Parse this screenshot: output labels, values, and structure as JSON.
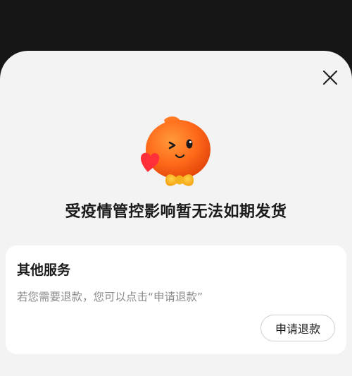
{
  "dialog": {
    "headline": "受疫情管控影响暂无法如期发货",
    "close_icon": "close-icon",
    "mascot_icon": "orange-mascot-winking",
    "accent_color": "#ff6a1a"
  },
  "service_card": {
    "title": "其他服务",
    "description": "若您需要退款，您可以点击“申请退款”",
    "refund_button_label": "申请退款"
  }
}
